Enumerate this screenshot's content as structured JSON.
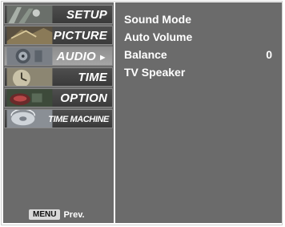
{
  "menu": {
    "items": [
      {
        "label": "SETUP"
      },
      {
        "label": "PICTURE"
      },
      {
        "label": "AUDIO",
        "arrow": "►"
      },
      {
        "label": "TIME"
      },
      {
        "label": "OPTION"
      },
      {
        "label": "TIME MACHINE"
      }
    ],
    "active_index": 2
  },
  "submenu": {
    "sound_mode": "Sound Mode",
    "auto_volume": "Auto Volume",
    "balance": "Balance",
    "balance_value": "0",
    "tv_speaker": "TV Speaker"
  },
  "footer": {
    "menu_key": "MENU",
    "prev_label": "Prev."
  },
  "colors": {
    "panel": "#6b6b6b",
    "item": "#444444",
    "item_active": "#9a9a9a",
    "text": "#ffffff"
  },
  "icons": [
    "setup-thumbnail",
    "picture-thumbnail",
    "audio-thumbnail",
    "time-thumbnail",
    "option-thumbnail",
    "time-machine-thumbnail"
  ]
}
